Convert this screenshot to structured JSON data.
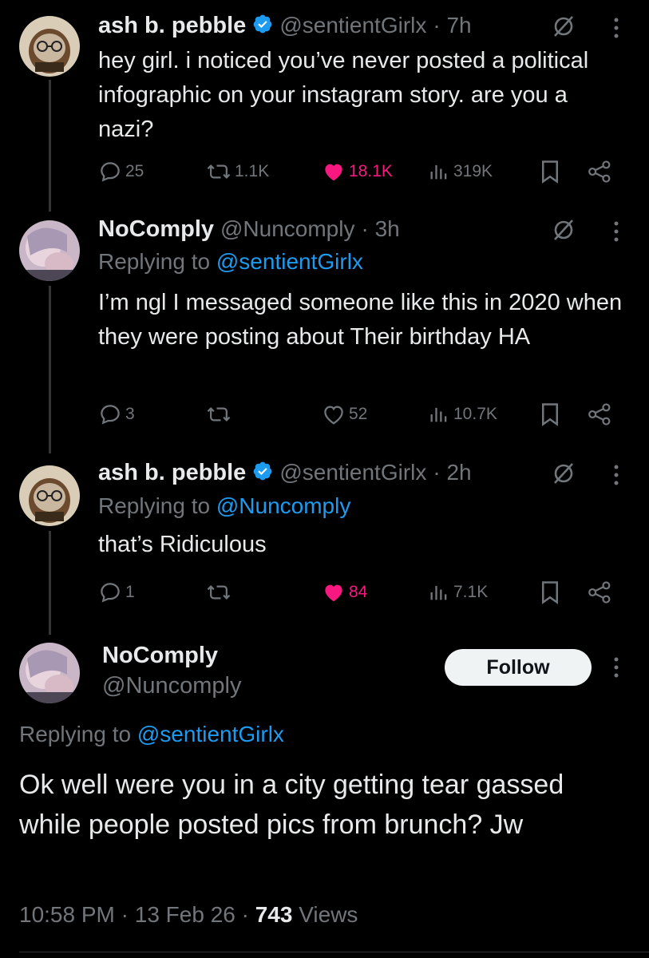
{
  "tweets": [
    {
      "name": "ash b. pebble",
      "handle": "@sentientGirlx",
      "time": "· 7h",
      "verified": true,
      "body": "hey girl. i noticed you’ve never posted a political infographic on your instagram story. are you a nazi?",
      "stats": {
        "replies": "25",
        "reposts": "1.1K",
        "likes": "18.1K",
        "views": "319K"
      },
      "liked": true
    },
    {
      "name": "NoComply",
      "handle": "@Nuncomply",
      "time": "· 3h",
      "verified": false,
      "replying_label": "Replying to",
      "replying_to": "@sentientGirlx",
      "body": "I’m ngl I messaged someone like this in 2020 when they were posting about Their birthday HA",
      "stats": {
        "replies": "3",
        "reposts": "",
        "likes": "52",
        "views": "10.7K"
      },
      "liked": false
    },
    {
      "name": "ash b. pebble",
      "handle": "@sentientGirlx",
      "time": "· 2h",
      "verified": true,
      "replying_label": "Replying to",
      "replying_to": "@Nuncomply",
      "body": "that’s Ridiculous",
      "stats": {
        "replies": "1",
        "reposts": "",
        "likes": "84",
        "views": "7.1K"
      },
      "liked": true
    }
  ],
  "main_tweet": {
    "name": "NoComply",
    "handle": "@Nuncomply",
    "follow_label": "Follow",
    "replying_label": "Replying to",
    "replying_to": "@sentientGirlx",
    "body": "Ok well were you in a city getting tear gassed while people posted pics from brunch? Jw",
    "time": "10:58 PM",
    "date": "· 13 Feb 26 ·",
    "views_count": "743",
    "views_label": "Views"
  },
  "colors": {
    "background": "#000000",
    "text": "#e7e9ea",
    "secondary": "#71767b",
    "link": "#1d9bf0",
    "like": "#f91880",
    "verified": "#1d9bf0"
  },
  "icons": [
    "reply-icon",
    "repost-icon",
    "like-icon",
    "views-icon",
    "bookmark-icon",
    "share-icon",
    "grok-icon",
    "more-icon",
    "verified-badge-icon"
  ]
}
